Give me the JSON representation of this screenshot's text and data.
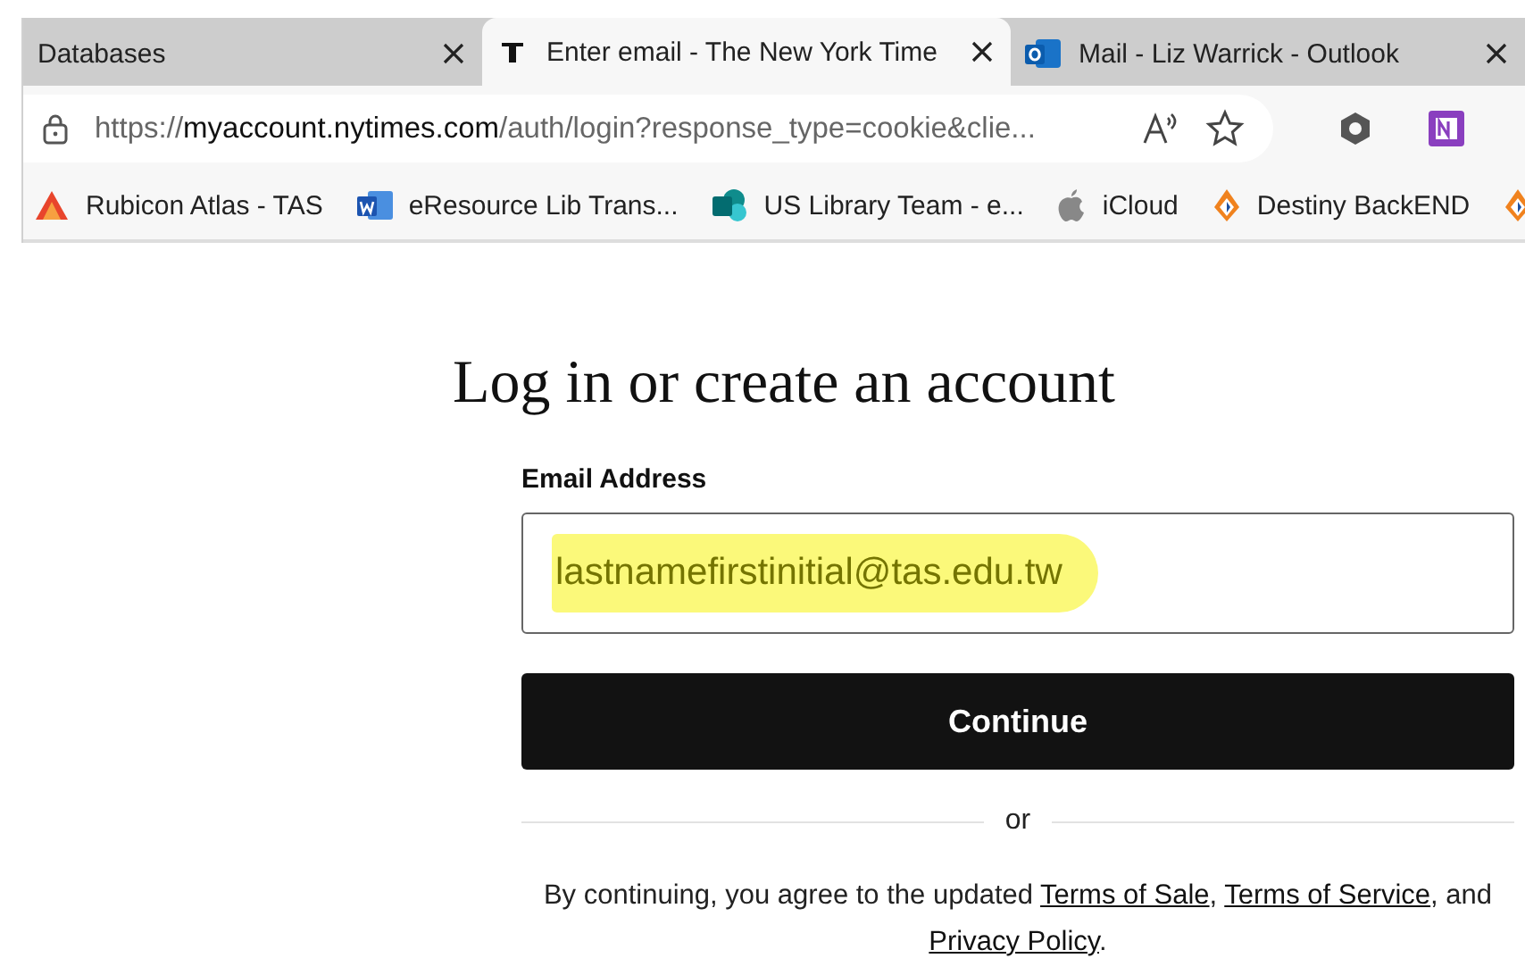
{
  "tabs": [
    {
      "title": "Databases",
      "kind": "plain",
      "selected": false
    },
    {
      "title": "Enter email - The New York Time",
      "kind": "news",
      "selected": true
    },
    {
      "title": "Mail - Liz Warrick - Outlook",
      "kind": "mail",
      "selected": false
    }
  ],
  "address_bar": {
    "url": {
      "scheme": "https://",
      "host": "myaccount.nytimes.com",
      "rest": "/auth/login?response_type=cookie&clie..."
    }
  },
  "bookmarks": [
    {
      "label": "Rubicon Atlas - TAS",
      "kind": "atlas"
    },
    {
      "label": "eResource Lib Trans...",
      "kind": "word"
    },
    {
      "label": "US Library Team - e...",
      "kind": "sharepoint"
    },
    {
      "label": "iCloud",
      "kind": "apple"
    },
    {
      "label": "Destiny BackEND",
      "kind": "destiny"
    },
    {
      "kind": "destiny"
    }
  ],
  "login": {
    "heading": "Log in or create an account",
    "email_label": "Email Address",
    "email_value": "lastnamefirstinitial@tas.edu.tw",
    "highlighted": true,
    "continue_button": "Continue",
    "divider_text": "or",
    "legal": [
      {
        "kind": "text",
        "text": "By continuing, you agree to the updated "
      },
      {
        "kind": "link",
        "text": "Terms of Sale"
      },
      {
        "kind": "text",
        "text": ", "
      },
      {
        "kind": "link",
        "text": "Terms of Service"
      },
      {
        "kind": "text",
        "text": ", and "
      },
      {
        "kind": "link",
        "text": "Privacy Policy"
      },
      {
        "kind": "text",
        "text": "."
      }
    ]
  }
}
